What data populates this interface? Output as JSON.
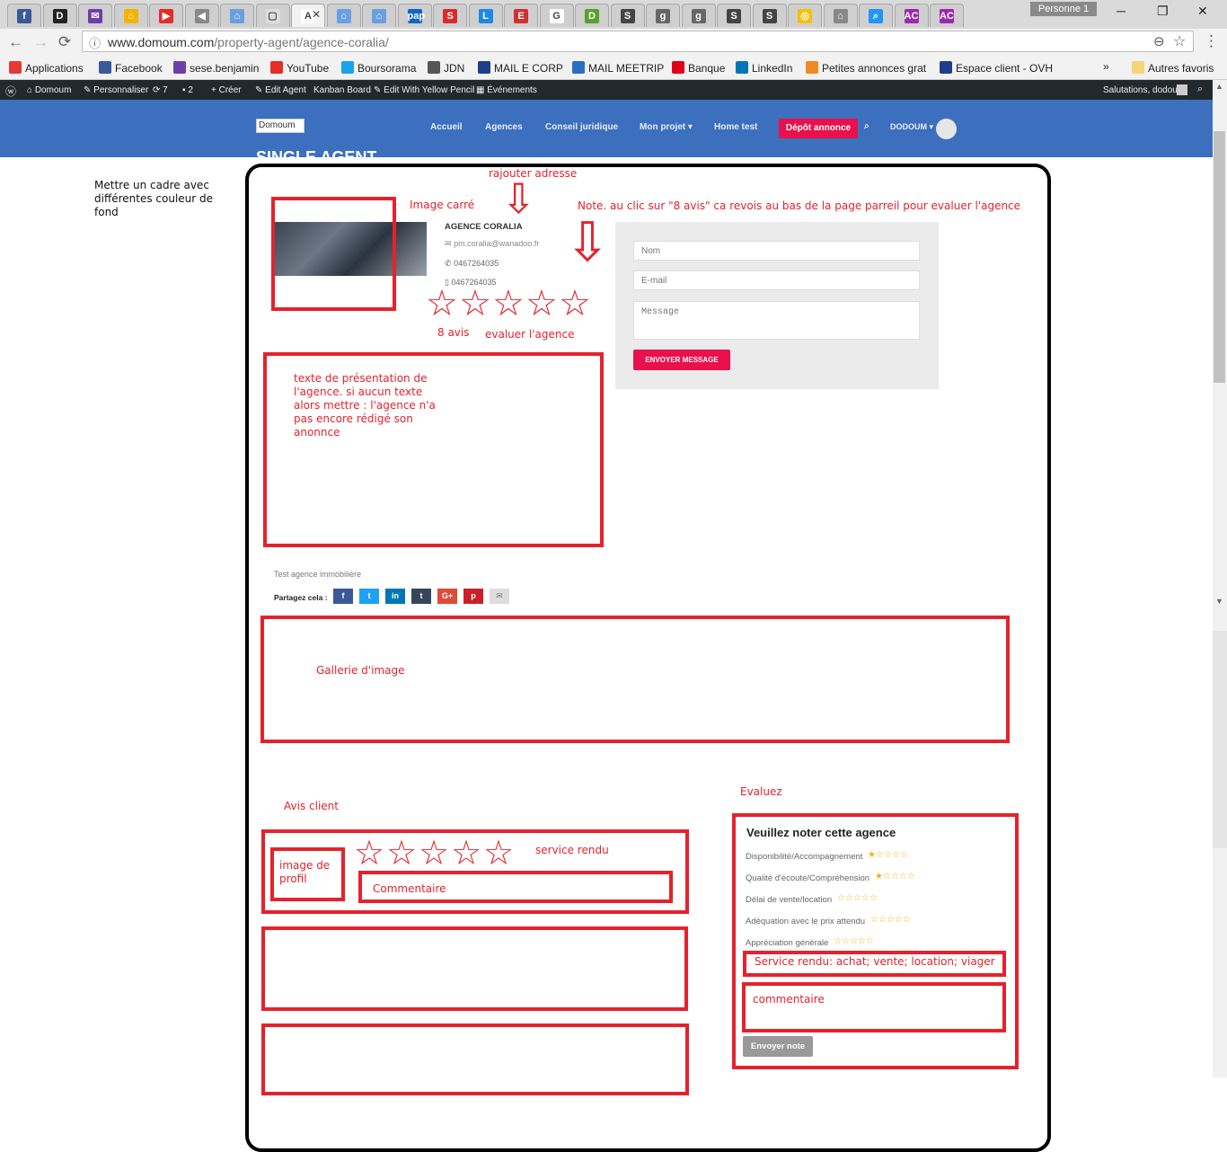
{
  "browser": {
    "profile_label": "Personne 1",
    "url_prefix": "www.domoum.com",
    "url_path": "/property-agent/agence-coralia/",
    "tab_active_title": "A",
    "minimize": "─",
    "restore": "❐",
    "close": "✕",
    "back": "←",
    "forward": "→",
    "reload": "⟳",
    "info": "ⓘ",
    "zoom": "⊖",
    "star": "☆",
    "menu": "⋮",
    "tab_close": "✕",
    "tab_letters": [
      "f",
      "D",
      "✉",
      "⌂",
      "▶",
      "◀",
      "⌂",
      "▢",
      "A",
      "⌂",
      "⌂",
      "pap",
      "S",
      "L",
      "E",
      "G",
      "D",
      "S",
      "g",
      "g",
      "S",
      "S",
      "◎",
      "⌂",
      "⌕",
      "AC",
      "AC"
    ],
    "tab_colors": [
      "#3b5998",
      "#222222",
      "#6c3fa8",
      "#f4b400",
      "#e52d27",
      "#888888",
      "#6aa0e0",
      "#dddddd",
      "#ffffff",
      "#6aa0e0",
      "#6aa0e0",
      "#1565c0",
      "#d92b2b",
      "#1e88e5",
      "#d32f2f",
      "#ffffff",
      "#5aa02c",
      "#444444",
      "#666666",
      "#666666",
      "#444444",
      "#444444",
      "#f4c20d",
      "#888888",
      "#2196f3",
      "#9c27b0",
      "#9c27b0"
    ]
  },
  "bookmarks": {
    "items": [
      {
        "label": "Applications",
        "color": "#e53935"
      },
      {
        "label": "Facebook",
        "color": "#3b5998"
      },
      {
        "label": "sese.benjamin",
        "color": "#6c3fa8"
      },
      {
        "label": "YouTube",
        "color": "#e52d27"
      },
      {
        "label": "Boursorama",
        "color": "#1aa3e8"
      },
      {
        "label": "JDN",
        "color": "#555555"
      },
      {
        "label": "MAIL E CORP",
        "color": "#1f3d8a"
      },
      {
        "label": "MAIL MEETRIP",
        "color": "#2a6fbf"
      },
      {
        "label": "Banque",
        "color": "#e2001a"
      },
      {
        "label": "LinkedIn",
        "color": "#0077b5"
      },
      {
        "label": "Petites annonces grat",
        "color": "#f08a24"
      },
      {
        "label": "Espace client - OVH",
        "color": "#1f3d8a"
      }
    ],
    "more": "»",
    "other_label": "Autres favoris"
  },
  "adminbar": {
    "site": "Domoum",
    "customize": "Personnaliser",
    "updates": "7",
    "comments": "2",
    "new": "Créer",
    "edit": "Edit Agent",
    "kanban": "Kanban Board",
    "yellow": "Edit With Yellow Pencil",
    "events": "Événements",
    "greeting": "Salutations, dodoum"
  },
  "site": {
    "logo_alt": "Domoum",
    "nav": [
      "Accueil",
      "Agences",
      "Conseil juridique",
      "Mon projet",
      "Home test"
    ],
    "caret": "▾",
    "depot": "Dépôt annonce",
    "user": "DODOUM",
    "page_heading": "SINGLE AGENT"
  },
  "agent": {
    "name": "AGENCE CORALIA",
    "email": "pm.coralia@wanadoo.fr",
    "phone": "0467264035",
    "mobile": "0467264035",
    "mail_icon": "✉",
    "phone_icon": "✆",
    "mobile_icon": "▯",
    "description": "Test agence immobilière",
    "share_label": "Partagez cela :",
    "share_buttons": [
      {
        "icon": "f",
        "color": "#3b5998"
      },
      {
        "icon": "t",
        "color": "#1da1f2"
      },
      {
        "icon": "in",
        "color": "#0077b5"
      },
      {
        "icon": "t",
        "color": "#35465c"
      },
      {
        "icon": "G+",
        "color": "#dd4b39"
      },
      {
        "icon": "p",
        "color": "#cb2027"
      },
      {
        "icon": "✉",
        "color": "#dddddd"
      }
    ]
  },
  "contact_form": {
    "name_placeholder": "Nom",
    "email_placeholder": "E-mail",
    "message_placeholder": "Message",
    "send_label": "ENVOYER MESSAGE"
  },
  "annotations": {
    "side_note": "Mettre un cadre avec différentes couleur de fond",
    "add_address": "rajouter adresse",
    "image_square": "Image carré",
    "note_click": "Note. au clic sur \"8 avis\" ca revois au bas de la page parreil pour evaluer l'agence",
    "reviews_count": "8 avis",
    "rate_agency": "evaluer l'agence",
    "presentation": "texte de présentation de l'agence. si aucun texte alors mettre : l'agence n'a pas encore rédigé son anonnce",
    "gallery": "Gallerie d'image",
    "client_reviews": "Avis client",
    "profile_image": "image de profil",
    "service_rendered": "service rendu",
    "comment": "Commentaire",
    "evaluate": "Evaluez",
    "service_options": "Service rendu: achat; vente; location; viager",
    "comment_lower": "commentaire",
    "big_star": "☆",
    "arrow_down": "⇩"
  },
  "rating": {
    "title": "Veuillez noter cette agence",
    "criteria": [
      {
        "label": "Disponibilité/Accompagnement",
        "filled": 1
      },
      {
        "label": "Qualité d'écoute/Compréhension",
        "filled": 1
      },
      {
        "label": "Délai de vente/location",
        "filled": 0
      },
      {
        "label": "Adéquation avec le prix attendu",
        "filled": 0
      },
      {
        "label": "Appréciation générale",
        "filled": 0
      }
    ],
    "max_stars": 5,
    "submit_label": "Envoyer note"
  }
}
